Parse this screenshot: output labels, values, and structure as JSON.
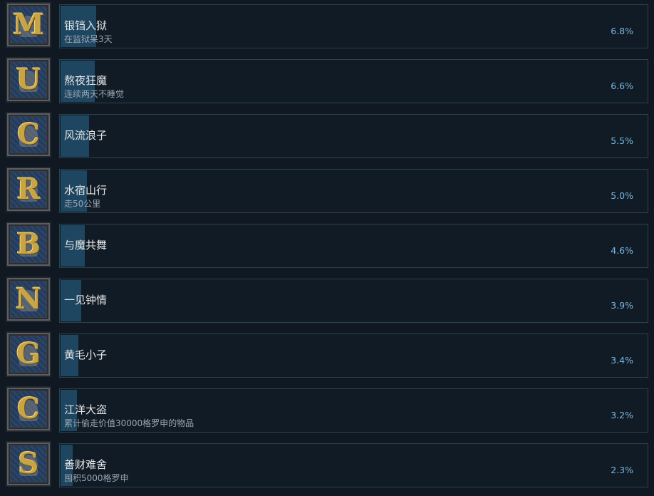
{
  "achievements": [
    {
      "title": "银铛入狱",
      "description": "在监狱呆3天",
      "percent_label": "6.8%",
      "percent": 0.068,
      "icon_letter": "M",
      "icon": "prisoner-in-cell-icon"
    },
    {
      "title": "熬夜狂魔",
      "description": "连续两天不睡觉",
      "percent_label": "6.6%",
      "percent": 0.066,
      "icon_letter": "U",
      "icon": "sleepless-man-icon"
    },
    {
      "title": "风流浪子",
      "description": "",
      "percent_label": "5.5%",
      "percent": 0.055,
      "icon_letter": "C",
      "icon": "couple-embracing-icon"
    },
    {
      "title": "水宿山行",
      "description": "走50公里",
      "percent_label": "5.0%",
      "percent": 0.05,
      "icon_letter": "R",
      "icon": "traveler-walking-icon"
    },
    {
      "title": "与魔共舞",
      "description": "",
      "percent_label": "4.6%",
      "percent": 0.046,
      "icon_letter": "B",
      "icon": "dancing-beast-icon"
    },
    {
      "title": "一见钟情",
      "description": "",
      "percent_label": "3.9%",
      "percent": 0.039,
      "icon_letter": "N",
      "icon": "lovestruck-figure-icon"
    },
    {
      "title": "黄毛小子",
      "description": "",
      "percent_label": "3.4%",
      "percent": 0.034,
      "icon_letter": "G",
      "icon": "young-squire-icon"
    },
    {
      "title": "江洋大盗",
      "description": "累计偷走价值30000格罗申的物品",
      "percent_label": "3.2%",
      "percent": 0.032,
      "icon_letter": "C",
      "icon": "hooded-thief-icon"
    },
    {
      "title": "善财难舍",
      "description": "囤积5000格罗申",
      "percent_label": "2.3%",
      "percent": 0.023,
      "icon_letter": "S",
      "icon": "coin-chest-icon"
    }
  ]
}
